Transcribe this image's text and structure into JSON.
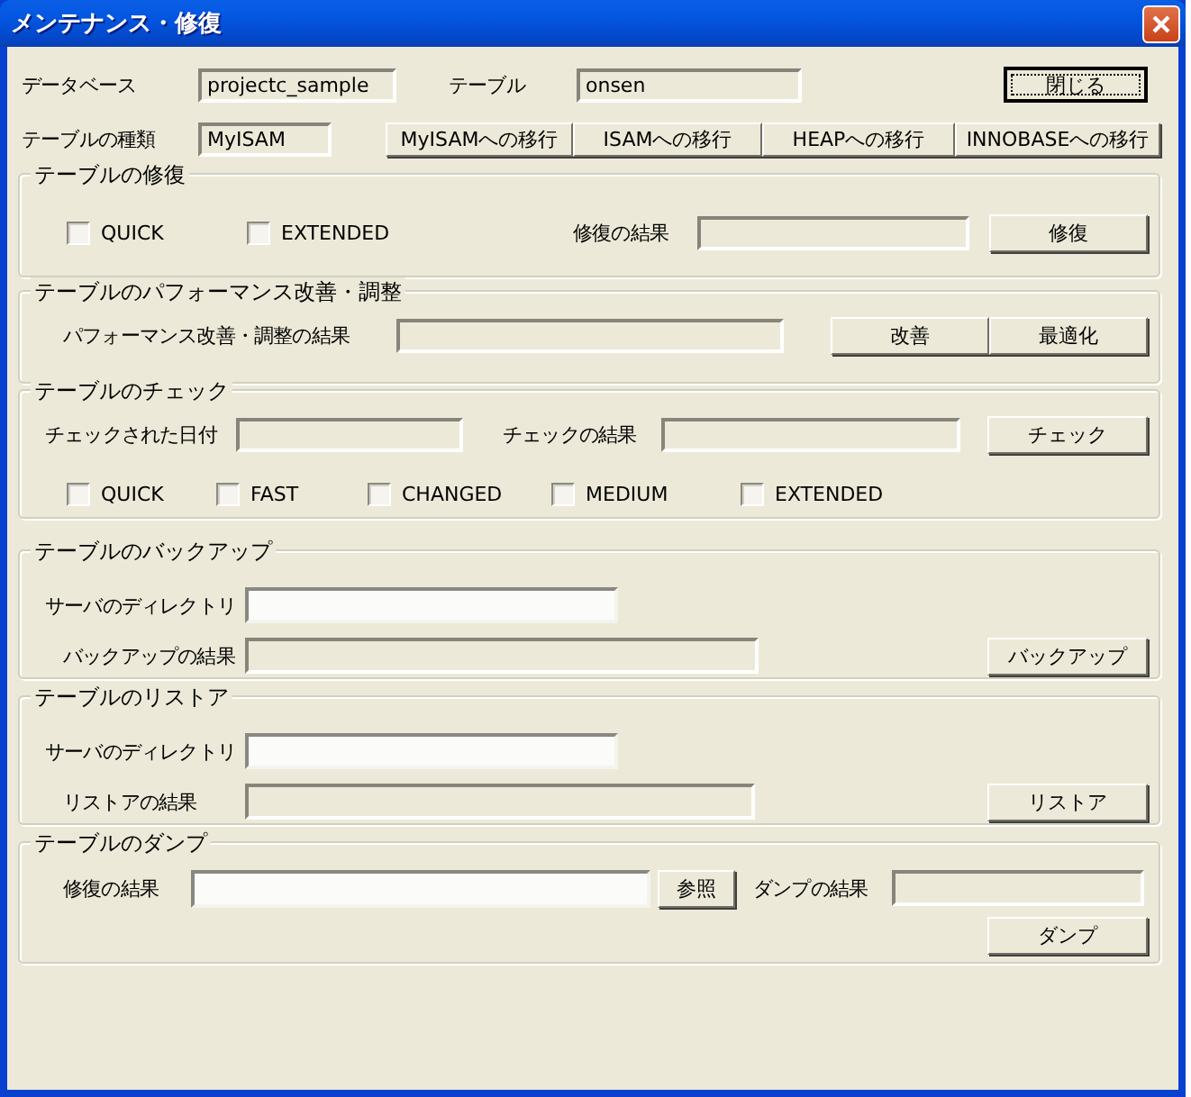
{
  "window": {
    "title": "メンテナンス・修復"
  },
  "header": {
    "database_label": "データベース",
    "database": "projectc_sample",
    "table_label": "テーブル",
    "table": "onsen",
    "close_button": {
      "label": "閉じる",
      "focused": true
    },
    "type_label": "テーブルの種類",
    "type": "MyISAM",
    "migrate_buttons": [
      "MyISAMへの移行",
      "ISAMへの移行",
      "HEAPへの移行",
      "INNOBASEへの移行"
    ]
  },
  "repair": {
    "title": "テーブルの修復",
    "options": [
      {
        "label": "QUICK",
        "checked": false
      },
      {
        "label": "EXTENDED",
        "checked": false
      }
    ],
    "result_label": "修復の結果",
    "button": "修復"
  },
  "optimize": {
    "title": "テーブルのパフォーマンス改善・調整",
    "result_label": "パフォーマンス改善・調整の結果",
    "buttons": [
      "改善",
      "最適化"
    ]
  },
  "check": {
    "title": "テーブルのチェック",
    "date_label": "チェックされた日付",
    "result_label": "チェックの結果",
    "button": "チェック",
    "options": [
      {
        "label": "QUICK",
        "checked": false
      },
      {
        "label": "FAST",
        "checked": false
      },
      {
        "label": "CHANGED",
        "checked": false
      },
      {
        "label": "MEDIUM",
        "checked": false
      },
      {
        "label": "EXTENDED",
        "checked": false
      }
    ]
  },
  "backup": {
    "title": "テーブルのバックアップ",
    "dir_label": "サーバのディレクトリ",
    "result_label": "バックアップの結果",
    "button": "バックアップ"
  },
  "restore": {
    "title": "テーブルのリストア",
    "dir_label": "サーバのディレクトリ",
    "result_label": "リストアの結果",
    "button": "リストア"
  },
  "dump": {
    "title": "テーブルのダンプ",
    "path_label": "修復の結果",
    "browse_button": "参照",
    "result_label": "ダンプの結果",
    "button": "ダンプ"
  }
}
